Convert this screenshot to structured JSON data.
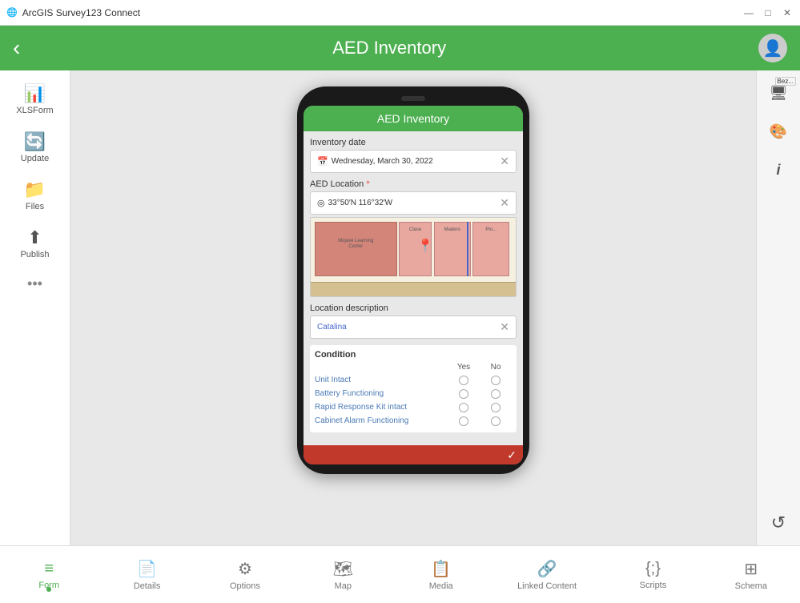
{
  "titlebar": {
    "app_name": "ArcGIS Survey123 Connect",
    "minimize": "—",
    "maximize": "□",
    "close": "✕"
  },
  "header": {
    "title": "AED Inventory",
    "back_label": "‹"
  },
  "sidebar": {
    "items": [
      {
        "id": "xlsform",
        "label": "XLSForm",
        "icon": "📊"
      },
      {
        "id": "update",
        "label": "Update",
        "icon": "🔄"
      },
      {
        "id": "files",
        "label": "Files",
        "icon": "📁"
      },
      {
        "id": "publish",
        "label": "Publish",
        "icon": "⬆"
      },
      {
        "id": "more",
        "label": "•••",
        "icon": ""
      }
    ]
  },
  "phone": {
    "screen_title": "AED Inventory",
    "form": {
      "inventory_date_label": "Inventory date",
      "inventory_date_value": "Wednesday, March 30, 2022",
      "location_label": "AED Location",
      "location_required": "*",
      "location_coords": "33°50′N 116°32′W",
      "location_desc_label": "Location description",
      "location_desc_value": "Catalina",
      "condition_label": "Condition",
      "condition_header_yes": "Yes",
      "condition_header_no": "No",
      "condition_rows": [
        {
          "label": "Unit Intact"
        },
        {
          "label": "Battery Functioning"
        },
        {
          "label": "Rapid Response Kit intact"
        },
        {
          "label": "Cabinet Alarm Functioning"
        }
      ]
    }
  },
  "right_tools": [
    {
      "id": "preview",
      "icon": "🖥",
      "label": "Bez..."
    },
    {
      "id": "style",
      "icon": "🎨"
    },
    {
      "id": "info",
      "icon": "ℹ"
    },
    {
      "id": "undo",
      "icon": "↺"
    }
  ],
  "bottom_tabs": [
    {
      "id": "form",
      "label": "Form",
      "active": true
    },
    {
      "id": "details",
      "label": "Details",
      "active": false
    },
    {
      "id": "options",
      "label": "Options",
      "active": false
    },
    {
      "id": "map",
      "label": "Map",
      "active": false
    },
    {
      "id": "media",
      "label": "Media",
      "active": false
    },
    {
      "id": "linked",
      "label": "Linked Content",
      "active": false
    },
    {
      "id": "scripts",
      "label": "Scripts",
      "active": false
    },
    {
      "id": "schema",
      "label": "Schema",
      "active": false
    }
  ]
}
